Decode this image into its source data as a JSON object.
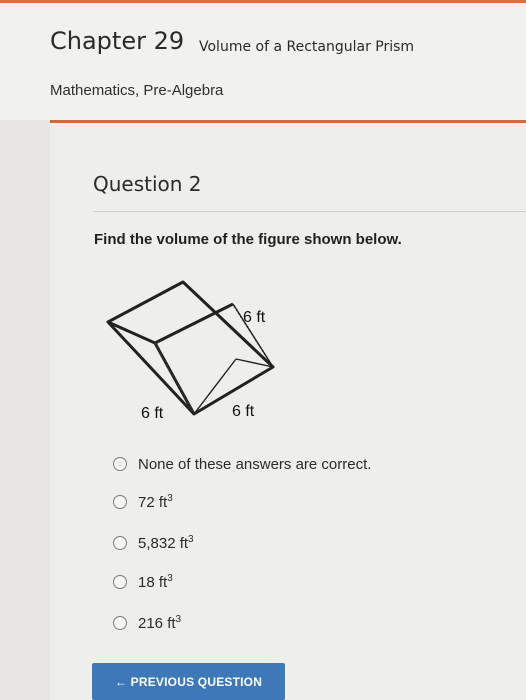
{
  "header": {
    "chapter_number": "Chapter 29",
    "chapter_title": "Volume of a Rectangular Prism",
    "subject": "Mathematics, Pre-Algebra"
  },
  "question": {
    "title": "Question 2",
    "prompt": "Find the volume of the figure shown below.",
    "figure": {
      "label_top": "6 ft",
      "label_bottom_left": "6 ft",
      "label_bottom_right": "6 ft"
    },
    "options": [
      {
        "text": "None of these answers are correct.",
        "sup": ""
      },
      {
        "text": "72 ft",
        "sup": "3"
      },
      {
        "text": "5,832 ft",
        "sup": "3"
      },
      {
        "text": "18 ft",
        "sup": "3"
      },
      {
        "text": "216 ft",
        "sup": "3"
      }
    ]
  },
  "nav": {
    "previous_label": "← PREVIOUS QUESTION"
  }
}
